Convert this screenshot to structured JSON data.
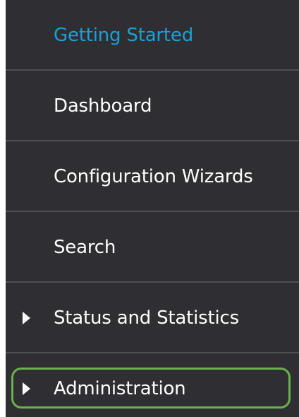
{
  "sidebar": {
    "items": [
      {
        "label": "Getting Started",
        "active": true,
        "expandable": false
      },
      {
        "label": "Dashboard",
        "active": false,
        "expandable": false
      },
      {
        "label": "Configuration Wizards",
        "active": false,
        "expandable": false
      },
      {
        "label": "Search",
        "active": false,
        "expandable": false
      },
      {
        "label": "Status and Statistics",
        "active": false,
        "expandable": true
      },
      {
        "label": "Administration",
        "active": false,
        "expandable": true,
        "highlighted": true
      }
    ]
  },
  "colors": {
    "background": "#2f2f33",
    "active_text": "#1ba0d7",
    "text": "#ffffff",
    "divider": "#4e4e54",
    "highlight_border": "#6ab04c"
  }
}
